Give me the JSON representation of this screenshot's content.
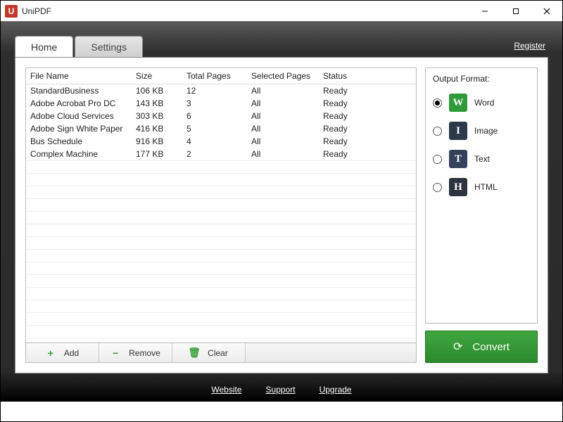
{
  "window": {
    "title": "UniPDF"
  },
  "tabs": {
    "home": "Home",
    "settings": "Settings",
    "register": "Register"
  },
  "table": {
    "headers": {
      "file": "File Name",
      "size": "Size",
      "pages": "Total Pages",
      "selected": "Selected Pages",
      "status": "Status"
    },
    "rows": [
      {
        "file": "StandardBusiness",
        "size": "106 KB",
        "pages": "12",
        "selected": "All",
        "status": "Ready"
      },
      {
        "file": "Adobe Acrobat Pro DC",
        "size": "143 KB",
        "pages": "3",
        "selected": "All",
        "status": "Ready"
      },
      {
        "file": "Adobe Cloud Services",
        "size": "303 KB",
        "pages": "6",
        "selected": "All",
        "status": "Ready"
      },
      {
        "file": "Adobe Sign White Paper",
        "size": "416 KB",
        "pages": "5",
        "selected": "All",
        "status": "Ready"
      },
      {
        "file": "Bus Schedule",
        "size": "916 KB",
        "pages": "4",
        "selected": "All",
        "status": "Ready"
      },
      {
        "file": "Complex Machine",
        "size": "177 KB",
        "pages": "2",
        "selected": "All",
        "status": "Ready"
      }
    ]
  },
  "toolbar": {
    "add": "Add",
    "remove": "Remove",
    "clear": "Clear"
  },
  "sidebar": {
    "title": "Output Format:",
    "options": {
      "word": {
        "label": "Word",
        "letter": "W",
        "selected": true
      },
      "image": {
        "label": "Image",
        "letter": "I",
        "selected": false
      },
      "text": {
        "label": "Text",
        "letter": "T",
        "selected": false
      },
      "html": {
        "label": "HTML",
        "letter": "H",
        "selected": false
      }
    },
    "convert": "Convert"
  },
  "footer": {
    "website": "Website",
    "support": "Support",
    "upgrade": "Upgrade"
  }
}
